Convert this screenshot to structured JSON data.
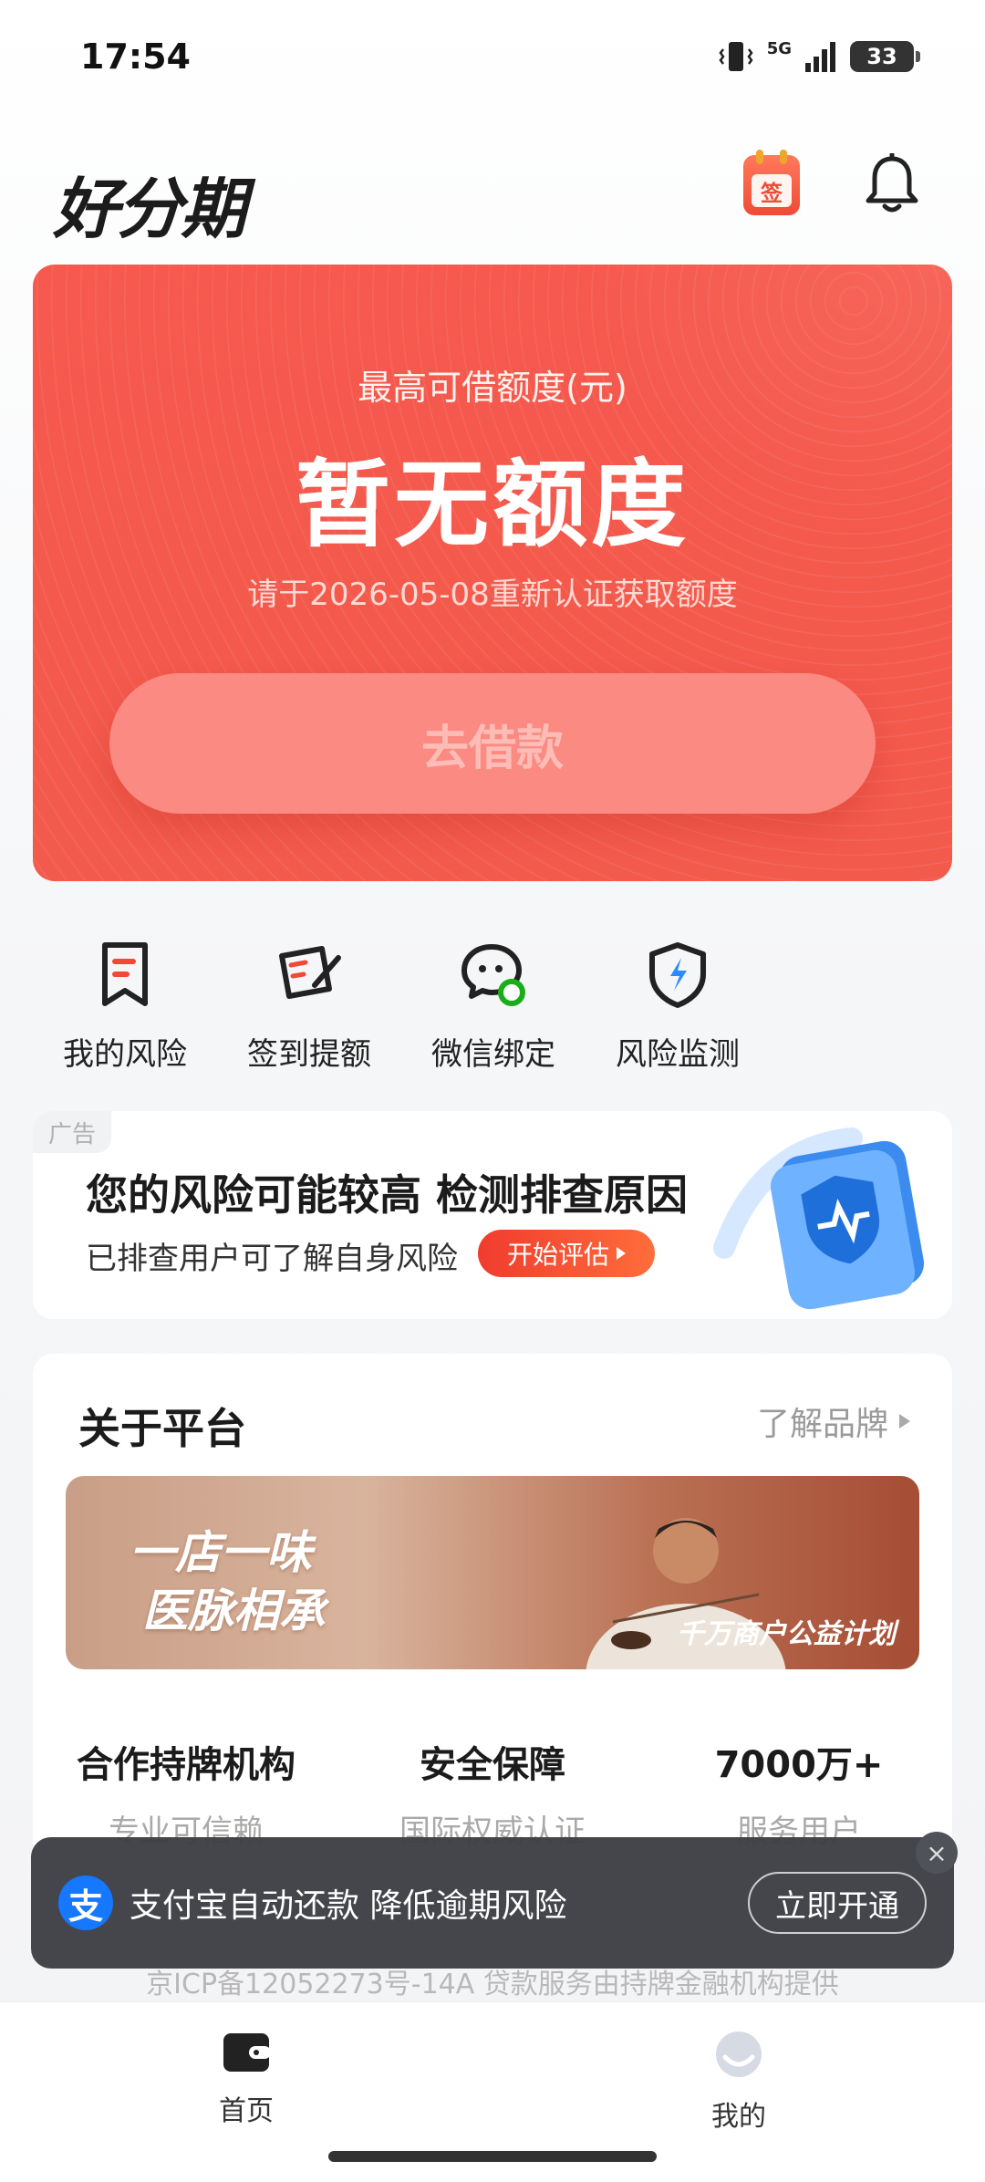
{
  "status_bar": {
    "time": "17:54",
    "network": "5G",
    "battery": "33"
  },
  "header": {
    "logo": "好分期",
    "checkin_glyph": "签"
  },
  "credit_card": {
    "label": "最高可借额度(元)",
    "amount": "暂无额度",
    "hint": "请于2026-05-08重新认证获取额度",
    "borrow_button": "去借款"
  },
  "quick_menu": [
    {
      "label": "我的风险",
      "icon": "bookmark-icon"
    },
    {
      "label": "签到提额",
      "icon": "sign-pen-icon"
    },
    {
      "label": "微信绑定",
      "icon": "wechat-icon"
    },
    {
      "label": "风险监测",
      "icon": "shield-lightning-icon"
    }
  ],
  "ad_banner": {
    "tag": "广告",
    "title": "您的风险可能较高 检测排查原因",
    "subtitle": "已排查用户可了解自身风险",
    "cta": "开始评估"
  },
  "platform": {
    "title": "关于平台",
    "link": "了解品牌",
    "banner_slogan_line1": "一店一味",
    "banner_slogan_line2": "医脉相承",
    "banner_plan": "千万商户公益计划",
    "stats": [
      {
        "value": "合作持牌机构",
        "sub": "专业可信赖"
      },
      {
        "value": "安全保障",
        "sub": "国际权威认证"
      },
      {
        "value": "7000万+",
        "sub": "服务用户"
      }
    ]
  },
  "toast": {
    "icon_glyph": "支",
    "text": "支付宝自动还款 降低逾期风险",
    "button": "立即开通",
    "close": "×"
  },
  "footer": {
    "icp": "京ICP备12052273号-14A 贷款服务由持牌金融机构提供"
  },
  "bottom_nav": [
    {
      "label": "首页",
      "icon": "wallet-icon",
      "active": true
    },
    {
      "label": "我的",
      "icon": "profile-icon",
      "active": false
    }
  ],
  "colors": {
    "brand_red": "#f25a4c",
    "alipay_blue": "#1677ff",
    "button_pink": "#fb8a82"
  }
}
